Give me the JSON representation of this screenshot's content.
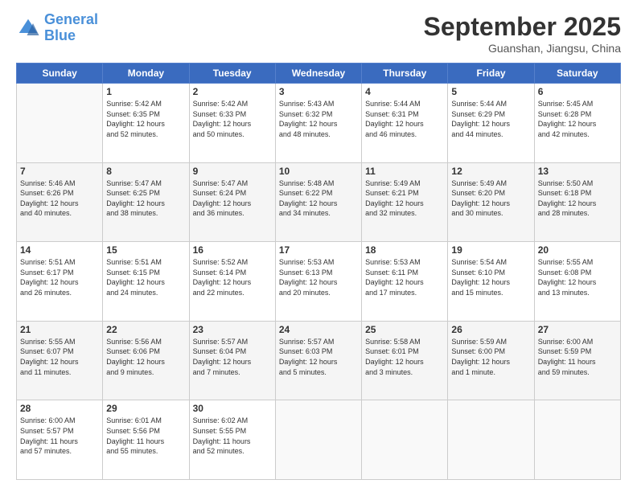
{
  "logo": {
    "line1": "General",
    "line2": "Blue"
  },
  "header": {
    "month": "September 2025",
    "location": "Guanshan, Jiangsu, China"
  },
  "weekdays": [
    "Sunday",
    "Monday",
    "Tuesday",
    "Wednesday",
    "Thursday",
    "Friday",
    "Saturday"
  ],
  "weeks": [
    [
      {
        "day": "",
        "info": ""
      },
      {
        "day": "1",
        "info": "Sunrise: 5:42 AM\nSunset: 6:35 PM\nDaylight: 12 hours\nand 52 minutes."
      },
      {
        "day": "2",
        "info": "Sunrise: 5:42 AM\nSunset: 6:33 PM\nDaylight: 12 hours\nand 50 minutes."
      },
      {
        "day": "3",
        "info": "Sunrise: 5:43 AM\nSunset: 6:32 PM\nDaylight: 12 hours\nand 48 minutes."
      },
      {
        "day": "4",
        "info": "Sunrise: 5:44 AM\nSunset: 6:31 PM\nDaylight: 12 hours\nand 46 minutes."
      },
      {
        "day": "5",
        "info": "Sunrise: 5:44 AM\nSunset: 6:29 PM\nDaylight: 12 hours\nand 44 minutes."
      },
      {
        "day": "6",
        "info": "Sunrise: 5:45 AM\nSunset: 6:28 PM\nDaylight: 12 hours\nand 42 minutes."
      }
    ],
    [
      {
        "day": "7",
        "info": "Sunrise: 5:46 AM\nSunset: 6:26 PM\nDaylight: 12 hours\nand 40 minutes."
      },
      {
        "day": "8",
        "info": "Sunrise: 5:47 AM\nSunset: 6:25 PM\nDaylight: 12 hours\nand 38 minutes."
      },
      {
        "day": "9",
        "info": "Sunrise: 5:47 AM\nSunset: 6:24 PM\nDaylight: 12 hours\nand 36 minutes."
      },
      {
        "day": "10",
        "info": "Sunrise: 5:48 AM\nSunset: 6:22 PM\nDaylight: 12 hours\nand 34 minutes."
      },
      {
        "day": "11",
        "info": "Sunrise: 5:49 AM\nSunset: 6:21 PM\nDaylight: 12 hours\nand 32 minutes."
      },
      {
        "day": "12",
        "info": "Sunrise: 5:49 AM\nSunset: 6:20 PM\nDaylight: 12 hours\nand 30 minutes."
      },
      {
        "day": "13",
        "info": "Sunrise: 5:50 AM\nSunset: 6:18 PM\nDaylight: 12 hours\nand 28 minutes."
      }
    ],
    [
      {
        "day": "14",
        "info": "Sunrise: 5:51 AM\nSunset: 6:17 PM\nDaylight: 12 hours\nand 26 minutes."
      },
      {
        "day": "15",
        "info": "Sunrise: 5:51 AM\nSunset: 6:15 PM\nDaylight: 12 hours\nand 24 minutes."
      },
      {
        "day": "16",
        "info": "Sunrise: 5:52 AM\nSunset: 6:14 PM\nDaylight: 12 hours\nand 22 minutes."
      },
      {
        "day": "17",
        "info": "Sunrise: 5:53 AM\nSunset: 6:13 PM\nDaylight: 12 hours\nand 20 minutes."
      },
      {
        "day": "18",
        "info": "Sunrise: 5:53 AM\nSunset: 6:11 PM\nDaylight: 12 hours\nand 17 minutes."
      },
      {
        "day": "19",
        "info": "Sunrise: 5:54 AM\nSunset: 6:10 PM\nDaylight: 12 hours\nand 15 minutes."
      },
      {
        "day": "20",
        "info": "Sunrise: 5:55 AM\nSunset: 6:08 PM\nDaylight: 12 hours\nand 13 minutes."
      }
    ],
    [
      {
        "day": "21",
        "info": "Sunrise: 5:55 AM\nSunset: 6:07 PM\nDaylight: 12 hours\nand 11 minutes."
      },
      {
        "day": "22",
        "info": "Sunrise: 5:56 AM\nSunset: 6:06 PM\nDaylight: 12 hours\nand 9 minutes."
      },
      {
        "day": "23",
        "info": "Sunrise: 5:57 AM\nSunset: 6:04 PM\nDaylight: 12 hours\nand 7 minutes."
      },
      {
        "day": "24",
        "info": "Sunrise: 5:57 AM\nSunset: 6:03 PM\nDaylight: 12 hours\nand 5 minutes."
      },
      {
        "day": "25",
        "info": "Sunrise: 5:58 AM\nSunset: 6:01 PM\nDaylight: 12 hours\nand 3 minutes."
      },
      {
        "day": "26",
        "info": "Sunrise: 5:59 AM\nSunset: 6:00 PM\nDaylight: 12 hours\nand 1 minute."
      },
      {
        "day": "27",
        "info": "Sunrise: 6:00 AM\nSunset: 5:59 PM\nDaylight: 11 hours\nand 59 minutes."
      }
    ],
    [
      {
        "day": "28",
        "info": "Sunrise: 6:00 AM\nSunset: 5:57 PM\nDaylight: 11 hours\nand 57 minutes."
      },
      {
        "day": "29",
        "info": "Sunrise: 6:01 AM\nSunset: 5:56 PM\nDaylight: 11 hours\nand 55 minutes."
      },
      {
        "day": "30",
        "info": "Sunrise: 6:02 AM\nSunset: 5:55 PM\nDaylight: 11 hours\nand 52 minutes."
      },
      {
        "day": "",
        "info": ""
      },
      {
        "day": "",
        "info": ""
      },
      {
        "day": "",
        "info": ""
      },
      {
        "day": "",
        "info": ""
      }
    ]
  ]
}
